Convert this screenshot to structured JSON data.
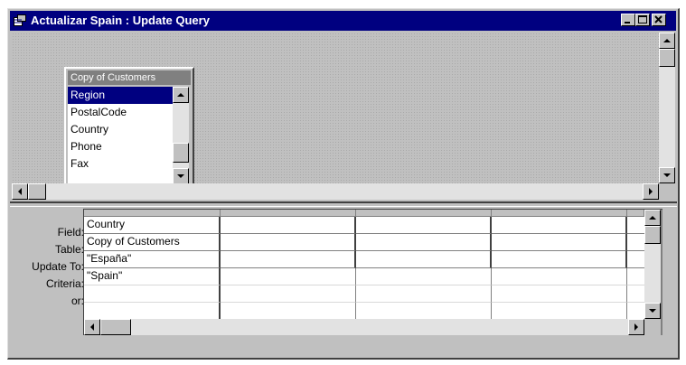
{
  "window": {
    "title": "Actualizar Spain : Update Query",
    "colors": {
      "titlebar": "#000080",
      "face": "#c0c0c0",
      "selection": "#000080"
    }
  },
  "title_buttons": [
    {
      "name": "minimize-button",
      "icon": "minimize-icon"
    },
    {
      "name": "maximize-button",
      "icon": "maximize-icon"
    },
    {
      "name": "close-button",
      "icon": "close-icon"
    }
  ],
  "table_box": {
    "caption": "Copy of Customers",
    "fields": [
      "Region",
      "PostalCode",
      "Country",
      "Phone",
      "Fax"
    ],
    "selected_index": 0
  },
  "design_grid": {
    "row_labels": [
      "Field:",
      "Table:",
      "Update To:",
      "Criteria:",
      "or:"
    ],
    "columns": [
      {
        "field": "Country",
        "table": "Copy of Customers",
        "update_to": "\"España\"",
        "criteria": "\"Spain\"",
        "or": ""
      },
      {
        "field": "",
        "table": "",
        "update_to": "",
        "criteria": "",
        "or": ""
      },
      {
        "field": "",
        "table": "",
        "update_to": "",
        "criteria": "",
        "or": ""
      },
      {
        "field": "",
        "table": "",
        "update_to": "",
        "criteria": "",
        "or": ""
      },
      {
        "field": "",
        "table": "",
        "update_to": "",
        "criteria": "",
        "or": ""
      }
    ]
  }
}
